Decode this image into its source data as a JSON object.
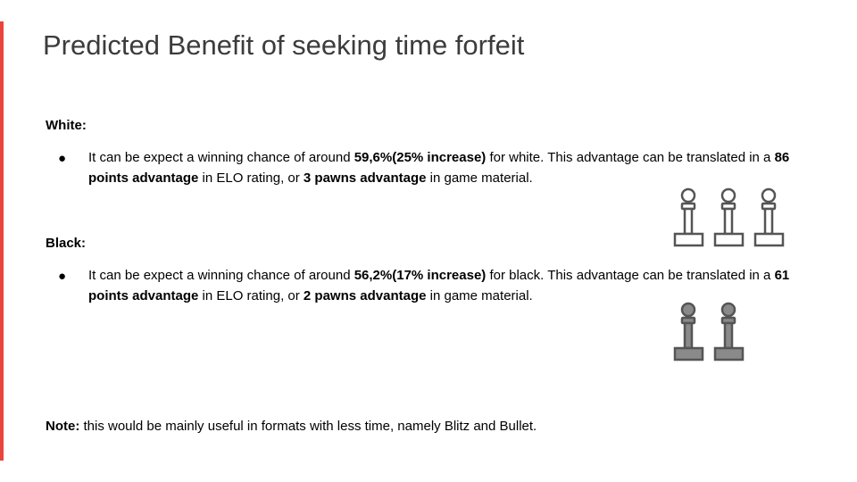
{
  "slide": {
    "title": "Predicted Benefit of seeking time forfeit"
  },
  "white": {
    "label": "White:",
    "bullet": {
      "pre": "It can be expect a winning chance of around ",
      "chance": "59,6%(25% increase)",
      "mid1": " for white. This advantage can be translated in a ",
      "elo": "86 points advantage",
      "mid2": " in ELO rating, or ",
      "pawns": "3 pawns advantage",
      "post": " in game material."
    },
    "pawn_icons": [
      "pawn-icon",
      "pawn-icon",
      "pawn-icon"
    ]
  },
  "black": {
    "label": "Black:",
    "bullet": {
      "pre": "It can be expect a winning chance of around ",
      "chance": "56,2%(17% increase)",
      "mid1": " for black. This advantage can be translated in a ",
      "elo": "61 points advantage",
      "mid2": " in ELO rating, or ",
      "pawns": "2 pawns advantage",
      "post": " in game material."
    },
    "pawn_icons": [
      "pawn-icon",
      "pawn-icon"
    ]
  },
  "note": {
    "label": "Note:",
    "text": " this would be mainly useful in formats with less time, namely Blitz and Bullet."
  },
  "bullet_glyph": "●",
  "colors": {
    "accent": "#e8453c",
    "title": "#3c3c3c",
    "white_pawn_fill": "#ffffff",
    "black_pawn_fill": "#8a8a8a",
    "pawn_outline": "#555555"
  }
}
